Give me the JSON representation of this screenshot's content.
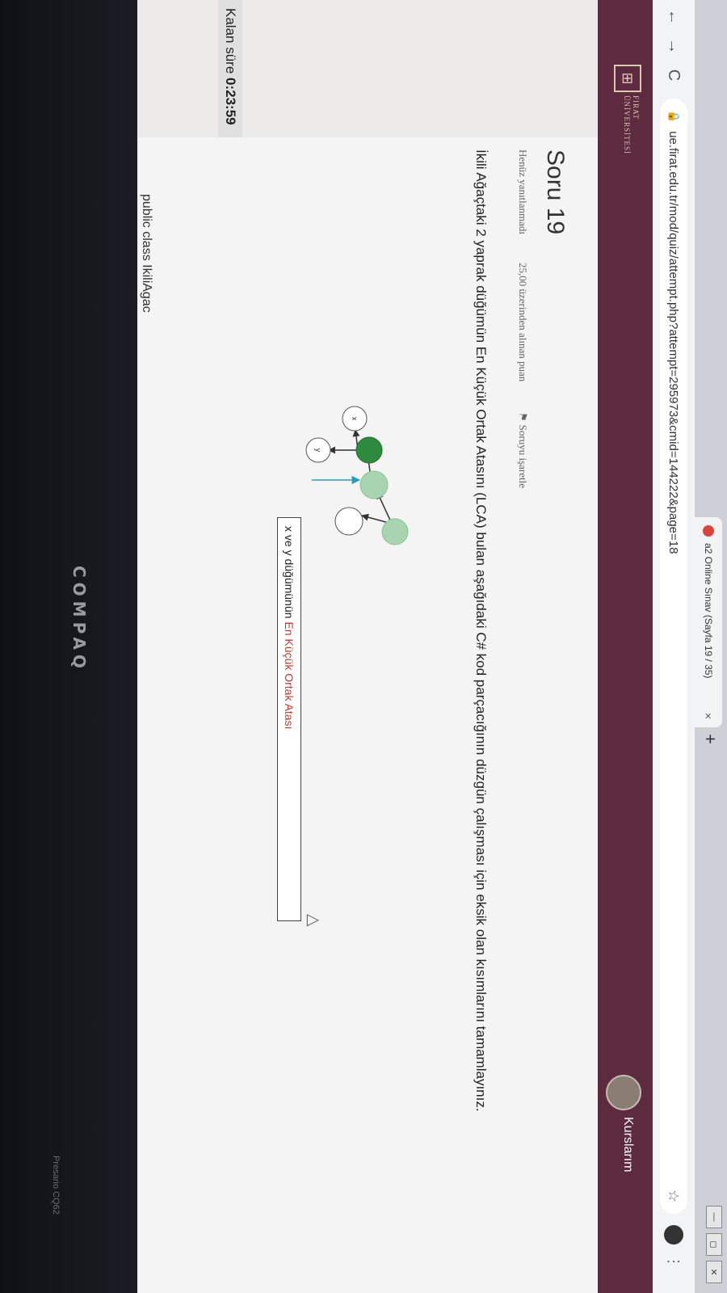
{
  "browser": {
    "tab_title": "a2 Online Sınav (Sayfa 19 / 35)",
    "tab_close": "×",
    "new_tab": "+",
    "window_controls": [
      "—",
      "◻",
      "✕"
    ],
    "url": "ue.firat.edu.tr/mod/quiz/attempt.php?attempt=295973&cmid=144222&page=18",
    "nav": {
      "back": "←",
      "forward": "→",
      "reload": "C"
    },
    "icons": {
      "lock": "lock-icon",
      "star": "star-icon",
      "menu": "menu-icon"
    }
  },
  "header": {
    "logo_mark": "⊞",
    "logo_text": "FIRAT ÜNİVERSİTESİ",
    "my_courses": "Kurslarım",
    "bg_color": "#5e2a40"
  },
  "quiz": {
    "timer_label": "Kalan süre",
    "timer_value": "0:23:59",
    "question_title": "Soru 19",
    "status": "Henüz yanıtlanmadı",
    "points": "25,00 üzerinden alınan puan",
    "flag_label": "Soruyu işaretle",
    "question_text": "İkili Ağaçtaki 2 yaprak düğümün En Küçük Ortak Atasını (LCA) bulan aşağıdaki C# kod parçacığının düzgün çalışması için eksik olan kısımlarını tamamlayınız.",
    "diagram": {
      "node_labels": {
        "x": "x",
        "y": "y"
      },
      "callout_prefix": "x ve y düğümünün",
      "callout_highlight": "En Küçük Ortak Atası",
      "colors": {
        "lca": "#2e8b3e",
        "ancestor": "#a8d5b0",
        "leaf": "#ffffff",
        "arrow": "#2a9bbd"
      }
    },
    "code_line": "public class IkiliAgac"
  },
  "laptop": {
    "brand": "COMPAQ",
    "model": "Presario CQ62"
  }
}
